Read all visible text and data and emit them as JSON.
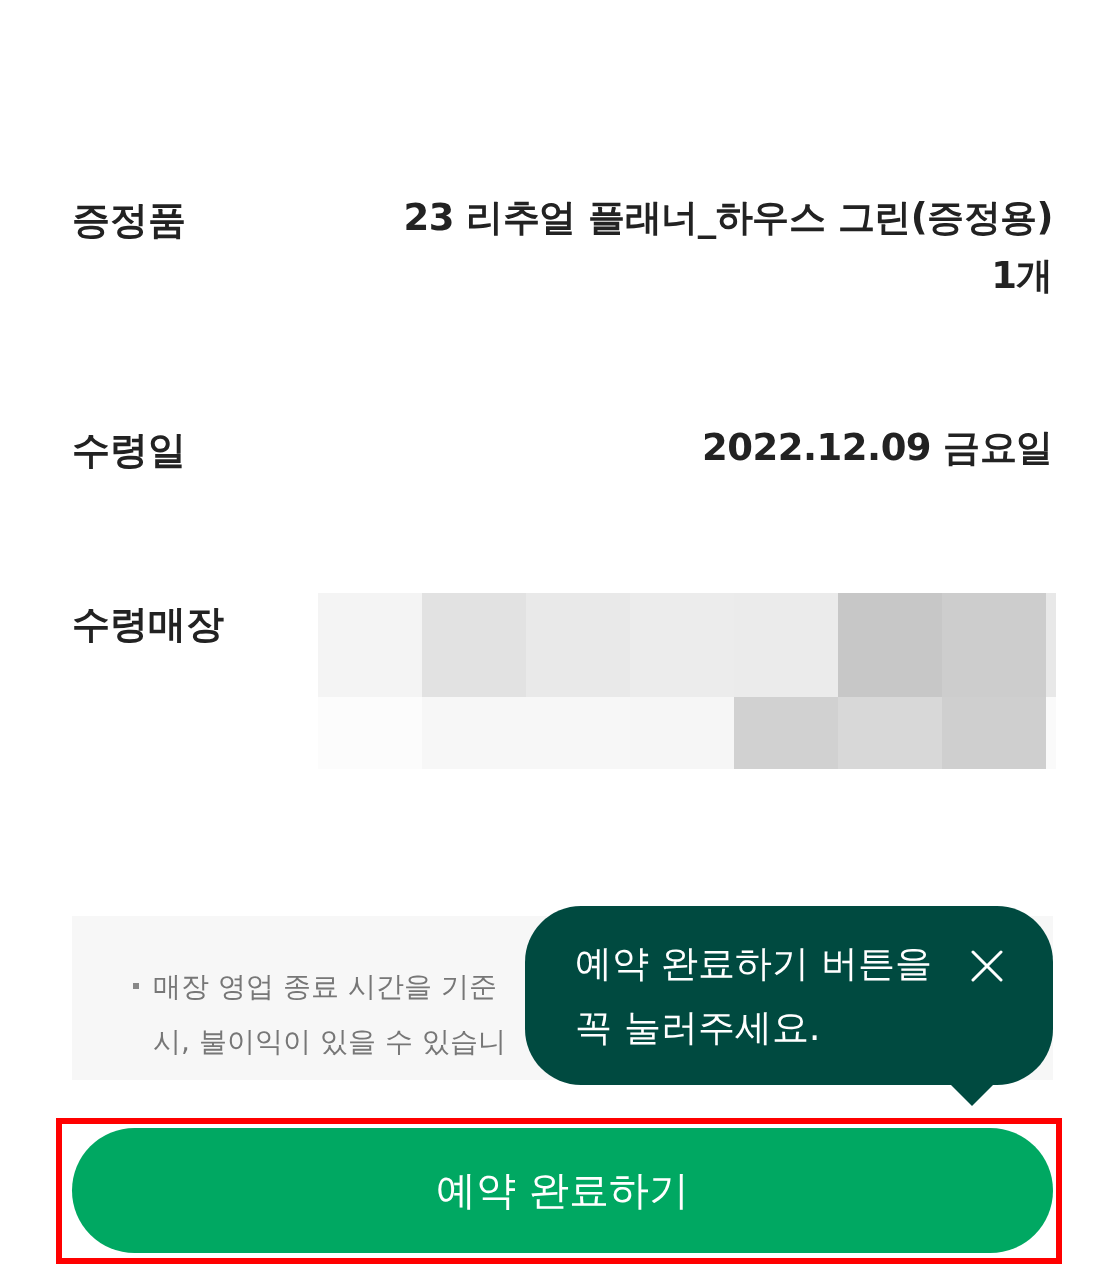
{
  "details": [
    {
      "kind": "text",
      "label": "증정품",
      "lines": [
        "23 리추얼 플래너_하우스 그린(증정용)",
        "1개"
      ]
    },
    {
      "kind": "text",
      "label": "수령일",
      "lines": [
        "2022.12.09 금요일"
      ]
    },
    {
      "kind": "redacted",
      "label": "수령매장"
    }
  ],
  "notice": {
    "lines": [
      "매장 영업 종료 시간을 기준",
      "시, 불이익이 있을 수 있습니"
    ]
  },
  "tooltip": {
    "text": "예약 완료하기 버튼을 꼭 눌러주세요."
  },
  "button": {
    "label": "예약 완료하기",
    "highlighted": true
  }
}
